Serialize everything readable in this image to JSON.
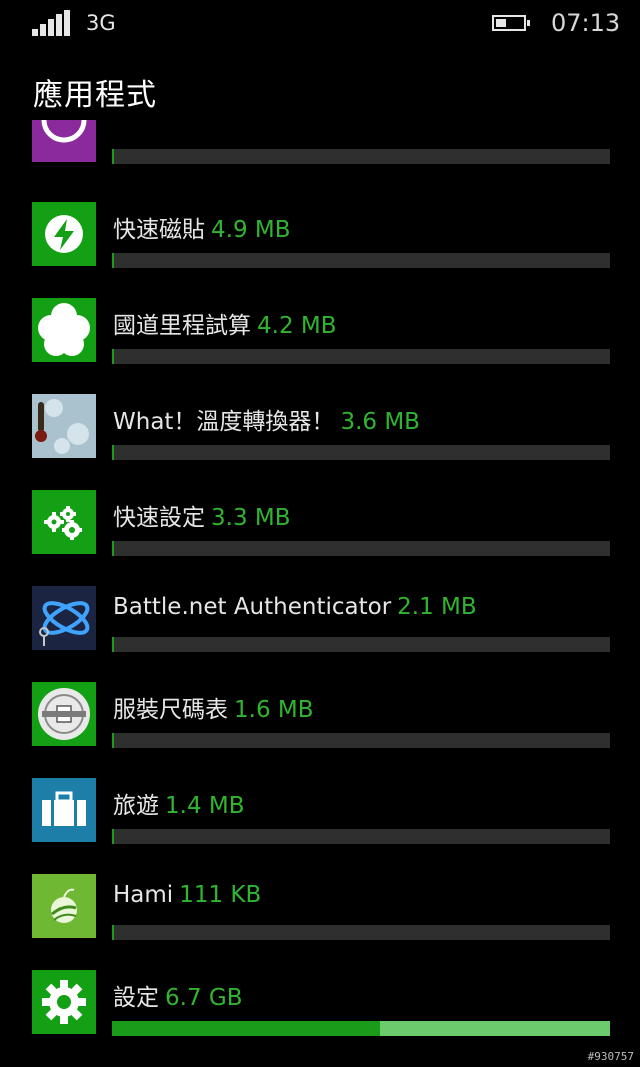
{
  "status_bar": {
    "network": "3G",
    "time": "07:13"
  },
  "page_title": "應用程式",
  "apps": [
    {
      "name": "",
      "size": "",
      "icon": "purple-circle-icon",
      "tile_color": "#8a2a9c",
      "usage": 0.0
    },
    {
      "name": "快速磁貼",
      "size": "4.9 MB",
      "icon": "power-bolt-icon",
      "tile_color": "#14a014",
      "usage": 0.003
    },
    {
      "name": "國道里程試算",
      "size": "4.2 MB",
      "icon": "flower-badge-icon",
      "tile_color": "#14a014",
      "usage": 0.003
    },
    {
      "name": "What！溫度轉換器！",
      "size": "3.6 MB",
      "icon": "thermometer-icon",
      "tile_color": "#9fb9c6",
      "usage": 0.003
    },
    {
      "name": "快速設定",
      "size": "3.3 MB",
      "icon": "gears-icon",
      "tile_color": "#14a014",
      "usage": 0.003
    },
    {
      "name": "Battle.net Authenticator",
      "size": "2.1 MB",
      "icon": "battlenet-logo-icon",
      "tile_color": "#1b2440",
      "usage": 0.003
    },
    {
      "name": "服裝尺碼表",
      "size": "1.6 MB",
      "icon": "size-badge-icon",
      "tile_color": "#14a014",
      "usage": 0.003
    },
    {
      "name": "旅遊",
      "size": "1.4 MB",
      "icon": "suitcase-icon",
      "tile_color": "#1d7fa8",
      "usage": 0.003
    },
    {
      "name": "Hami",
      "size": "111 KB",
      "icon": "hami-globe-icon",
      "tile_color": "#6fb833",
      "usage": 0.003
    },
    {
      "name": "設定",
      "size": "6.7 GB",
      "icon": "settings-gear-icon",
      "tile_color": "#14a014",
      "usage": 0.54,
      "usage_secondary": 0.46
    }
  ],
  "watermark": "#930757",
  "colors": {
    "accent": "#14a014",
    "size_text": "#31b531",
    "bar_bg": "#2f2f2f",
    "bar_secondary": "#6ccb6c"
  }
}
